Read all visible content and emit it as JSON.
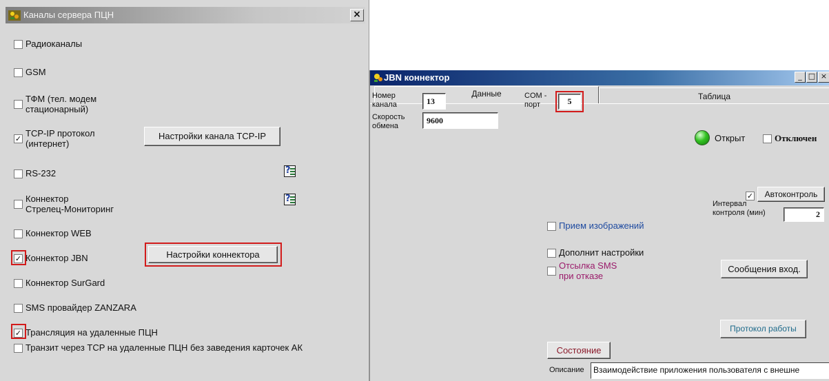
{
  "left_window": {
    "title": "Каналы сервера ПЦН",
    "close_glyph": "×",
    "items": [
      {
        "label": "Радиоканалы",
        "checked": false
      },
      {
        "label": "GSM",
        "checked": false
      },
      {
        "label": "ТФМ (тел. модем",
        "label2": "стационарный)",
        "checked": false
      },
      {
        "label": "TCP-IP протокол",
        "label2": "(интернет)",
        "checked": true
      },
      {
        "label": "RS-232",
        "checked": false
      },
      {
        "label": "Коннектор",
        "label2": "Стрелец-Мониторинг",
        "checked": false
      },
      {
        "label": "Коннектор WEB",
        "checked": false
      },
      {
        "label": "Коннектор JBN",
        "checked": true
      },
      {
        "label": "Коннектор SurGard",
        "checked": false
      },
      {
        "label": "SMS провайдер ZANZARA",
        "checked": false
      },
      {
        "label": "Трансляция  на удаленные ПЦН",
        "checked": true
      },
      {
        "label": "Транзит  через TCP на удаленные ПЦН без заведения карточек АК",
        "checked": false
      }
    ],
    "tcp_settings_button": "Настройки канала  TCP-IP",
    "connector_settings_button": "Настройки  коннектора",
    "check_glyph": "✓"
  },
  "right_window": {
    "title": "JBN коннектор",
    "controls": {
      "minimize": "_",
      "maximize": "□",
      "close": "×"
    },
    "tabs": [
      {
        "label": "Данные",
        "active": true
      },
      {
        "label": "Таблица",
        "active": false
      }
    ],
    "channel_label": "Номер канала",
    "channel_label_1": "Номер",
    "channel_label_2": "канала",
    "channel_value": "13",
    "com_label_1": "COM -",
    "com_label_2": "порт",
    "com_value": "5",
    "speed_label_1": "Скорость",
    "speed_label_2": "обмена",
    "speed_value": "9600",
    "status_text": "Открыт",
    "disabled_label": "Отключен",
    "disabled_checked": false,
    "autocontrol_label": "Автоконтроль",
    "autocontrol_checked": true,
    "interval_label_1": "Интервал",
    "interval_label_2": "контроля (мин)",
    "interval_value": "2",
    "image_receive_label": "Прием изображений",
    "image_receive_checked": false,
    "extra_settings_label": "Дополнит настройки",
    "extra_settings_checked": false,
    "sms_label_1": "Отсылка SMS",
    "sms_label_2": "при отказе",
    "sms_checked": false,
    "messages_button": "Сообщения вход.",
    "protocol_button": "Протокол работы",
    "state_button": "Состояние",
    "description_label": "Описание",
    "description_value": "Взаимодействие приложения пользователя с внешне"
  },
  "colors": {
    "highlight_red": "#d21b1b",
    "link_blue": "#1e4aa0",
    "sms_purple": "#9a1a6a",
    "protocol_teal": "#1e6a8a",
    "state_maroon": "#8a1a2a",
    "titlebar_blue": "#0a246a",
    "led_green": "#33c222"
  },
  "icons": [
    "app-icon",
    "close-icon",
    "help-book-icon",
    "status-led-icon",
    "minimize-icon",
    "maximize-icon"
  ]
}
